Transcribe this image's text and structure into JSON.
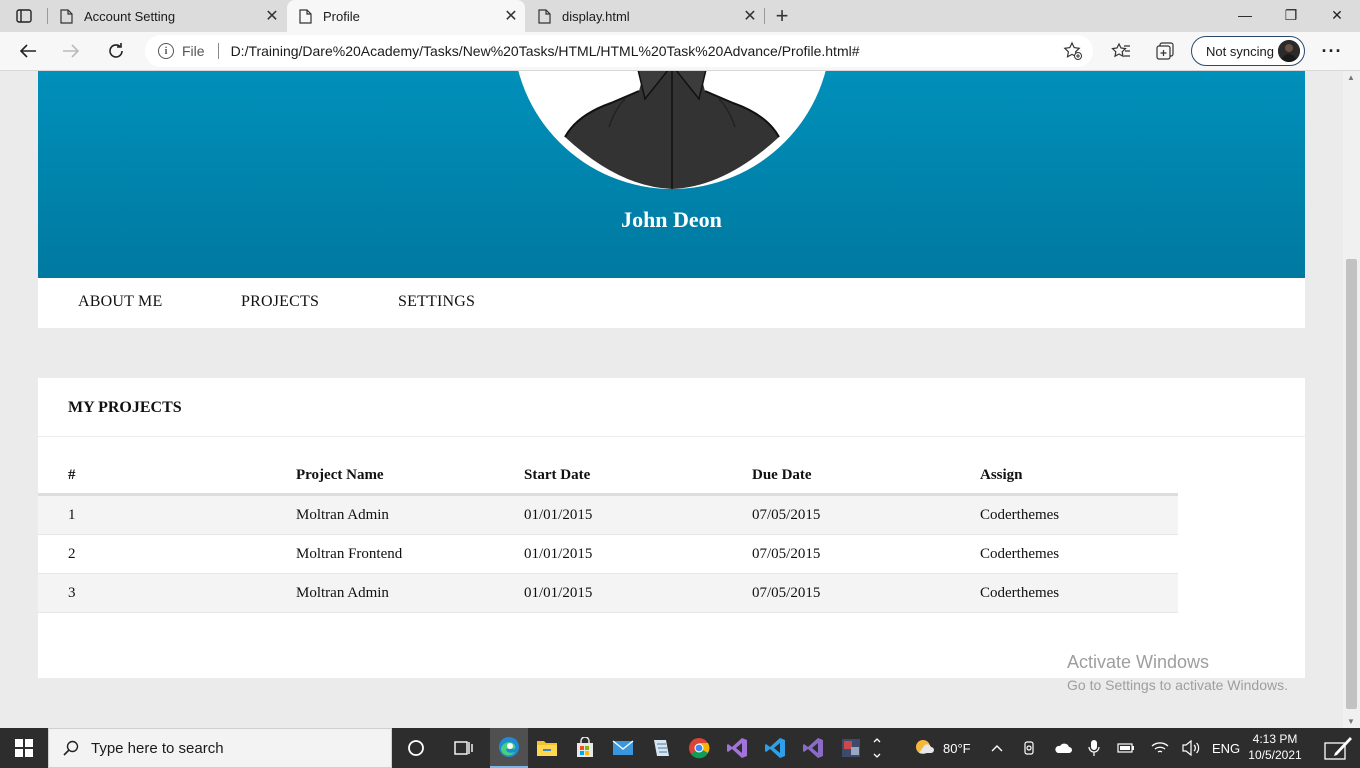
{
  "browser": {
    "tabs": [
      {
        "title": "Account Setting",
        "close": "✕"
      },
      {
        "title": "Profile",
        "close": "✕"
      },
      {
        "title": "display.html",
        "close": "✕"
      }
    ],
    "new_tab_glyph": "+",
    "window_controls": {
      "minimize": "—",
      "restore": "❐",
      "close": "✕"
    },
    "address": {
      "info_glyph": "i",
      "scheme_label": "File",
      "url": "D:/Training/Dare%20Academy/Tasks/New%20Tasks/HTML/HTML%20Task%20Advance/Profile.html#"
    },
    "sync_label": "Not syncing",
    "more_glyph": "···"
  },
  "page": {
    "profile_name": "John Deon",
    "nav": [
      "ABOUT ME",
      "PROJECTS",
      "SETTINGS"
    ],
    "projects": {
      "title": "MY PROJECTS",
      "columns": [
        "#",
        "Project Name",
        "Start Date",
        "Due Date",
        "Assign"
      ],
      "rows": [
        [
          "1",
          "Moltran Admin",
          "01/01/2015",
          "07/05/2015",
          "Coderthemes"
        ],
        [
          "2",
          "Moltran Frontend",
          "01/01/2015",
          "07/05/2015",
          "Coderthemes"
        ],
        [
          "3",
          "Moltran Admin",
          "01/01/2015",
          "07/05/2015",
          "Coderthemes"
        ]
      ]
    },
    "watermark": {
      "title": "Activate Windows",
      "subtitle": "Go to Settings to activate Windows."
    }
  },
  "taskbar": {
    "search_placeholder": "Type here to search",
    "weather": "80°F",
    "language": "ENG",
    "time": "4:13 PM",
    "date": "10/5/2021"
  },
  "colors": {
    "hero_top": "#0090ba",
    "hero_bottom": "#0079a0",
    "page_bg": "#ebebeb",
    "taskbar": "#2d2d2d"
  }
}
